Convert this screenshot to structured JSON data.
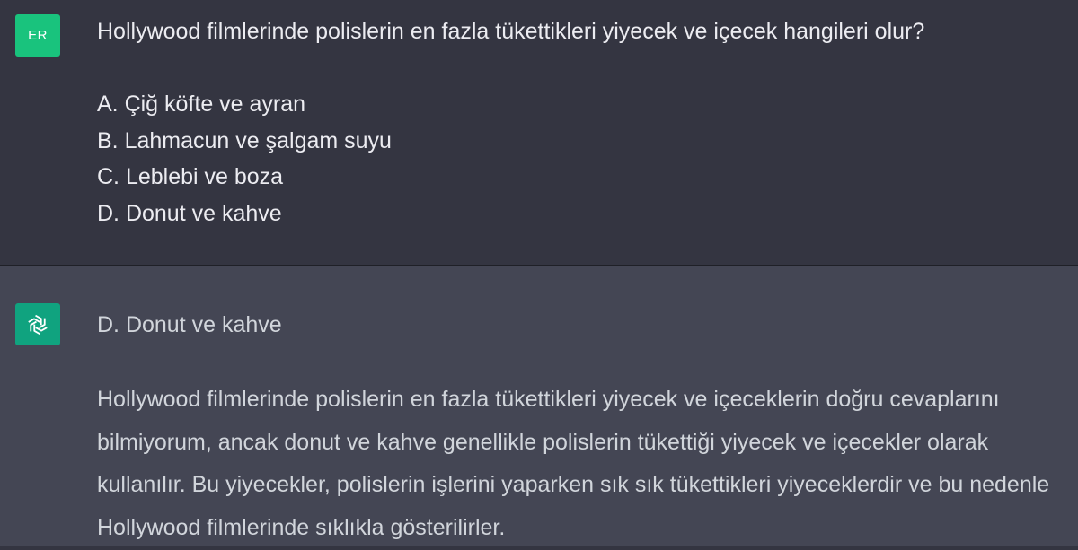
{
  "user": {
    "avatar_initials": "ER",
    "avatar_color": "#19c37d",
    "question": "Hollywood filmlerinde polislerin en fazla tükettikleri yiyecek ve içecek hangileri olur?",
    "options": [
      "A. Çiğ köfte ve ayran",
      "B. Lahmacun ve şalgam suyu",
      "C. Leblebi ve boza",
      "D. Donut ve kahve"
    ]
  },
  "assistant": {
    "avatar_icon": "openai-logo-icon",
    "avatar_color": "#10a37f",
    "answer": "D. Donut ve kahve",
    "explanation": "Hollywood filmlerinde polislerin en fazla tükettikleri yiyecek ve içeceklerin doğru cevaplarını bilmiyorum, ancak donut ve kahve genellikle polislerin tükettiği yiyecek ve içecekler olarak kullanılır. Bu yiyecekler, polislerin işlerini yaparken sık sık tükettikleri yiyeceklerdir ve bu nedenle Hollywood filmlerinde sıklıkla gösterilirler."
  },
  "colors": {
    "user_bg": "#343541",
    "assistant_bg": "#444654",
    "text": "#ececf1"
  }
}
